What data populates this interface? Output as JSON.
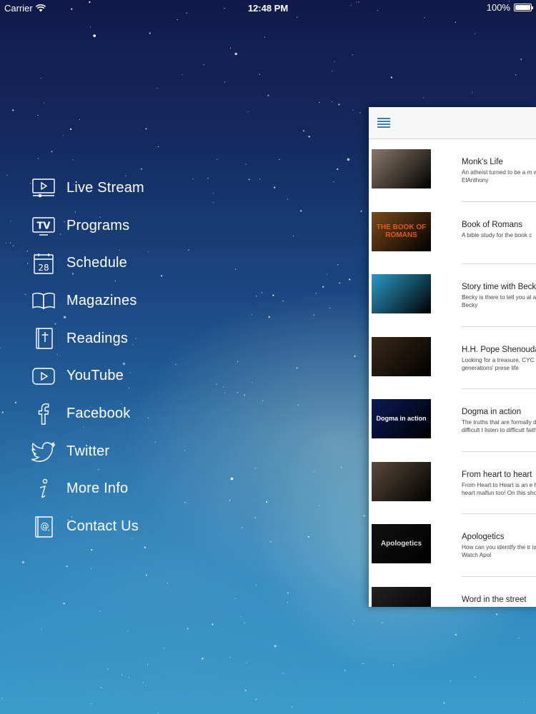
{
  "status_bar": {
    "carrier": "Carrier",
    "time": "12:48 PM",
    "battery": "100%"
  },
  "menu": [
    {
      "label": "Live Stream",
      "icon": "live-stream-icon"
    },
    {
      "label": "Programs",
      "icon": "tv-icon"
    },
    {
      "label": "Schedule",
      "icon": "calendar-icon",
      "icon_text": "28"
    },
    {
      "label": "Magazines",
      "icon": "book-icon"
    },
    {
      "label": "Readings",
      "icon": "bible-icon"
    },
    {
      "label": "YouTube",
      "icon": "youtube-icon"
    },
    {
      "label": "Facebook",
      "icon": "facebook-icon"
    },
    {
      "label": "Twitter",
      "icon": "twitter-icon"
    },
    {
      "label": "More Info",
      "icon": "info-icon"
    },
    {
      "label": "Contact Us",
      "icon": "contact-icon"
    }
  ],
  "programs": [
    {
      "title": "Monk's Life",
      "description": "An atheist turned to be a m with Fr. Lazarus ElAnthony",
      "thumb_color": "#8a7a6a"
    },
    {
      "title": "Book of Romans",
      "description": "A bible study for the book c",
      "thumb_color": "#7a4a1a",
      "thumb_text": "THE BOOK OF ROMANS"
    },
    {
      "title": "Story time with Beck",
      "description": "Becky is there to tell you al any story with Becky",
      "thumb_color": "#2a9ac8"
    },
    {
      "title": "H.H. Pope Shenouda",
      "description": "Looking for a treasure, CYC teacher generations' prese life",
      "thumb_color": "#3a2a1a"
    },
    {
      "title": "Dogma in action",
      "description": "The truths that are formally dogma issues are difficult t listen to difficult faith issue",
      "thumb_color": "#0a1a5a",
      "thumb_text": "Dogma in action"
    },
    {
      "title": "From heart to heart",
      "description": "From Heart to Heart is an e heart. Human heart malfun too! On this show you will l",
      "thumb_color": "#5a4a3a"
    },
    {
      "title": "Apologetics",
      "description": "How can you identify the tr is apologetics? Watch Apol",
      "thumb_color": "#111111",
      "thumb_text": "Apologetics"
    },
    {
      "title": "Word in the street",
      "description": "",
      "thumb_color": "#222222"
    }
  ]
}
